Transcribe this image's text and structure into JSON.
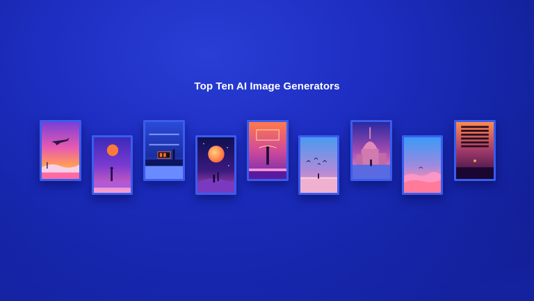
{
  "page": {
    "title": "Top Ten AI Image Generators"
  },
  "colors": {
    "background": "#1f2fc4",
    "frame_border": "#3a5cf0",
    "title_text": "#ffffff"
  },
  "artworks": [
    {
      "name": "sunset-airplane-artwork"
    },
    {
      "name": "moon-silhouette-artwork"
    },
    {
      "name": "neon-room-artwork"
    },
    {
      "name": "planet-figure-artwork"
    },
    {
      "name": "neon-gate-figure-artwork"
    },
    {
      "name": "birds-sky-artwork"
    },
    {
      "name": "domed-city-artwork"
    },
    {
      "name": "pink-clouds-artwork"
    },
    {
      "name": "window-blinds-artwork"
    }
  ]
}
